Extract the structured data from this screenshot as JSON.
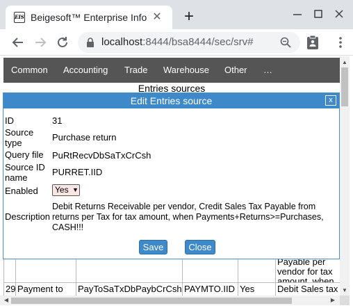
{
  "browser": {
    "tab_title": "Beigesoft™ Enterprise Info",
    "favicon_text": "EIS",
    "url_host": "localhost",
    "url_rest": ":8444/bsa8444/sec/srv#"
  },
  "app_nav": {
    "items": [
      "Common",
      "Accounting",
      "Trade",
      "Warehouse",
      "Other",
      "…"
    ]
  },
  "page": {
    "heading": "Entries sources"
  },
  "modal": {
    "title": "Edit Entries source",
    "close_label": "x",
    "fields": {
      "id_label": "ID",
      "id_value": "31",
      "source_type_label": "Source type",
      "source_type_value": "Purchase return",
      "query_file_label": "Query file",
      "query_file_value": "PuRtRecvDbSaTxCrCsh",
      "source_id_name_label": "Source ID name",
      "source_id_name_value": "PURRET.IID",
      "enabled_label": "Enabled",
      "enabled_value": "Yes",
      "description_label": "Description",
      "description_value": "Debit Returns Receivable per vendor, Credit Sales Tax Payable from returns per Tax for tax amount, when Payments+Returns>=Purchases, CASH!!!"
    },
    "save_label": "Save",
    "close_button_label": "Close"
  },
  "table": {
    "rows": [
      {
        "id": "",
        "source_type": "",
        "query_file": "",
        "source_id_name": "",
        "enabled": "",
        "description": "per tax, Credit Payable per vendor for tax amount, when Payments>=Pu"
      },
      {
        "id": "29",
        "source_type": "Payment to",
        "query_file": "PayToSaTxDbPaybCrCsh",
        "source_id_name": "PAYMTO.IID",
        "enabled": "Yes",
        "description": "Debit Sales tax"
      }
    ]
  }
}
